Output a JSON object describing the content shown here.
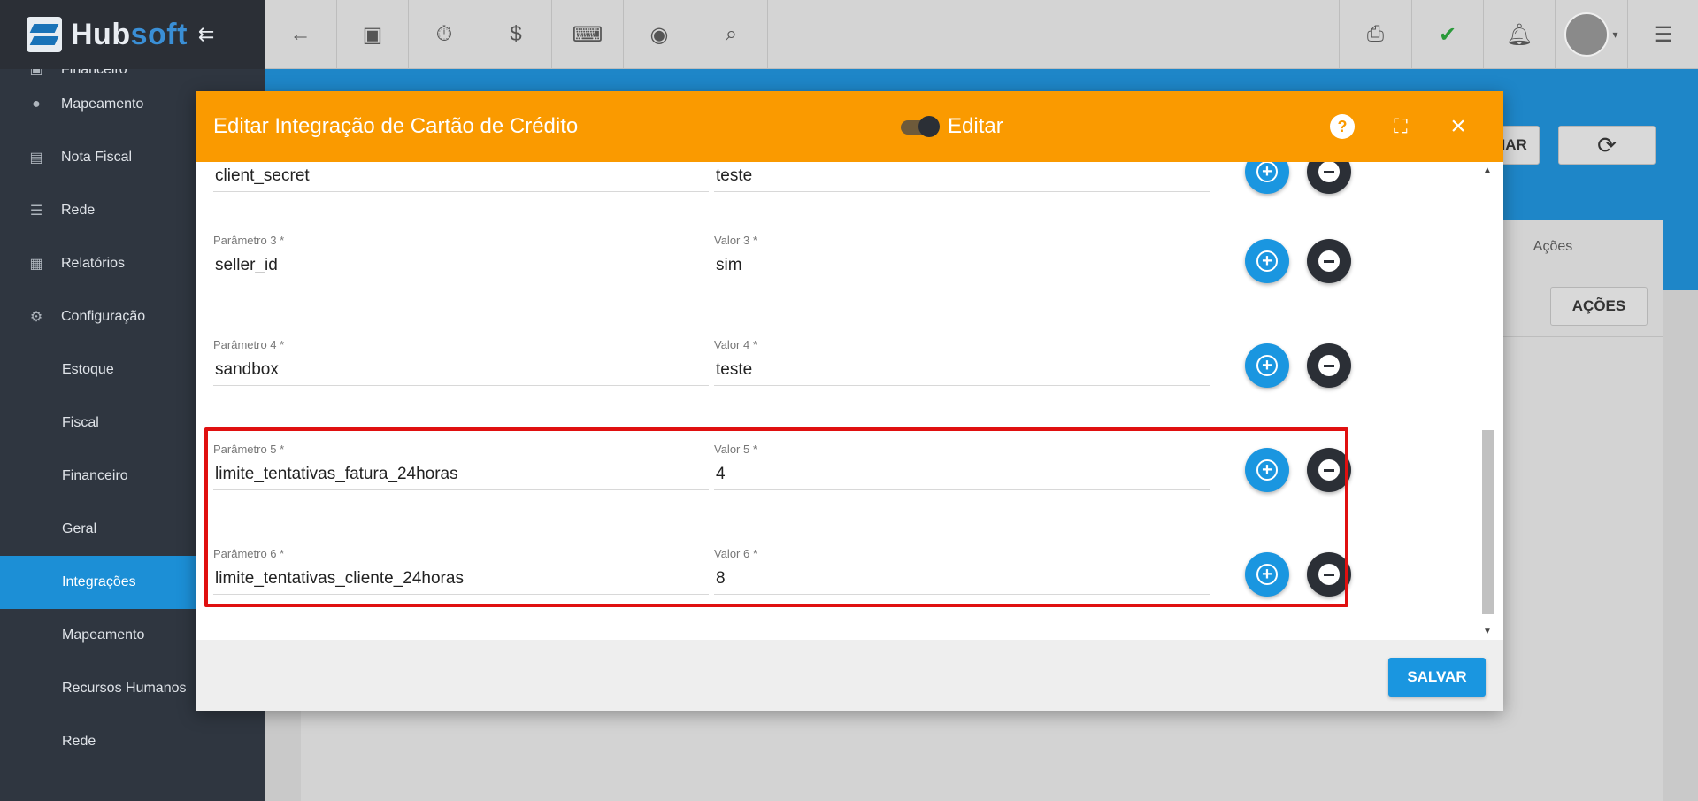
{
  "brand": {
    "hub": "Hub",
    "soft": "soft"
  },
  "sidebar": {
    "partial_item": "Financeiro",
    "items": [
      {
        "label": "Mapeamento",
        "icon": "map-pin-icon"
      },
      {
        "label": "Nota Fiscal",
        "icon": "document-icon"
      },
      {
        "label": "Rede",
        "icon": "network-icon"
      },
      {
        "label": "Relatórios",
        "icon": "report-icon"
      },
      {
        "label": "Configuração",
        "icon": "gear-icon"
      }
    ],
    "subitems": [
      {
        "label": "Estoque"
      },
      {
        "label": "Fiscal"
      },
      {
        "label": "Financeiro"
      },
      {
        "label": "Geral"
      },
      {
        "label": "Integrações",
        "active": true
      },
      {
        "label": "Mapeamento"
      },
      {
        "label": "Recursos Humanos"
      },
      {
        "label": "Rede"
      }
    ]
  },
  "background": {
    "acoes_header": "Ações",
    "acoes_button": "AÇÕES",
    "partial_button": "NAR"
  },
  "modal": {
    "title": "Editar Integração de Cartão de Crédito",
    "toggle_label": "Editar",
    "partial_row": {
      "param": "client_secret",
      "value": "teste"
    },
    "rows": [
      {
        "param_label": "Parâmetro 3 *",
        "param": "seller_id",
        "value_label": "Valor 3 *",
        "value": "sim"
      },
      {
        "param_label": "Parâmetro 4 *",
        "param": "sandbox",
        "value_label": "Valor 4 *",
        "value": "teste"
      },
      {
        "param_label": "Parâmetro 5 *",
        "param": "limite_tentativas_fatura_24horas",
        "value_label": "Valor 5 *",
        "value": "4"
      },
      {
        "param_label": "Parâmetro 6 *",
        "param": "limite_tentativas_cliente_24horas",
        "value_label": "Valor 6 *",
        "value": "8"
      }
    ],
    "save_label": "SALVAR"
  },
  "colors": {
    "header": "#fa9a00",
    "accent": "#1a96e0",
    "sidebar": "#2f3640",
    "highlight": "#e01010"
  }
}
